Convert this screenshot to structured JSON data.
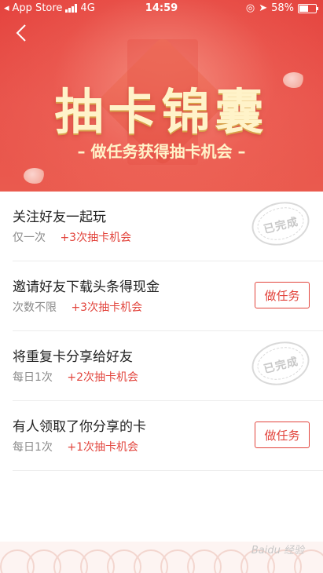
{
  "status_bar": {
    "carrier": "App Store",
    "network": "4G",
    "time": "14:59",
    "battery_percent": "58%",
    "battery_level": 0.58
  },
  "header": {
    "title": "抽卡锦囊",
    "subtitle": "– 做任务获得抽卡机会 –",
    "back_icon": "chevron-left-icon",
    "accent_color": "#e2443c",
    "title_color": "#fff3c9"
  },
  "tasks": [
    {
      "name": "关注好友一起玩",
      "frequency": "仅一次",
      "reward": "+3次抽卡机会",
      "state": "completed",
      "stamp_label": "已完成"
    },
    {
      "name": "邀请好友下载头条得现金",
      "frequency": "次数不限",
      "reward": "+3次抽卡机会",
      "state": "todo",
      "button_label": "做任务"
    },
    {
      "name": "将重复卡分享给好友",
      "frequency": "每日1次",
      "reward": "+2次抽卡机会",
      "state": "completed",
      "stamp_label": "已完成"
    },
    {
      "name": "有人领取了你分享的卡",
      "frequency": "每日1次",
      "reward": "+1次抽卡机会",
      "state": "todo",
      "button_label": "做任务"
    }
  ],
  "watermark": "Baidu 经验"
}
